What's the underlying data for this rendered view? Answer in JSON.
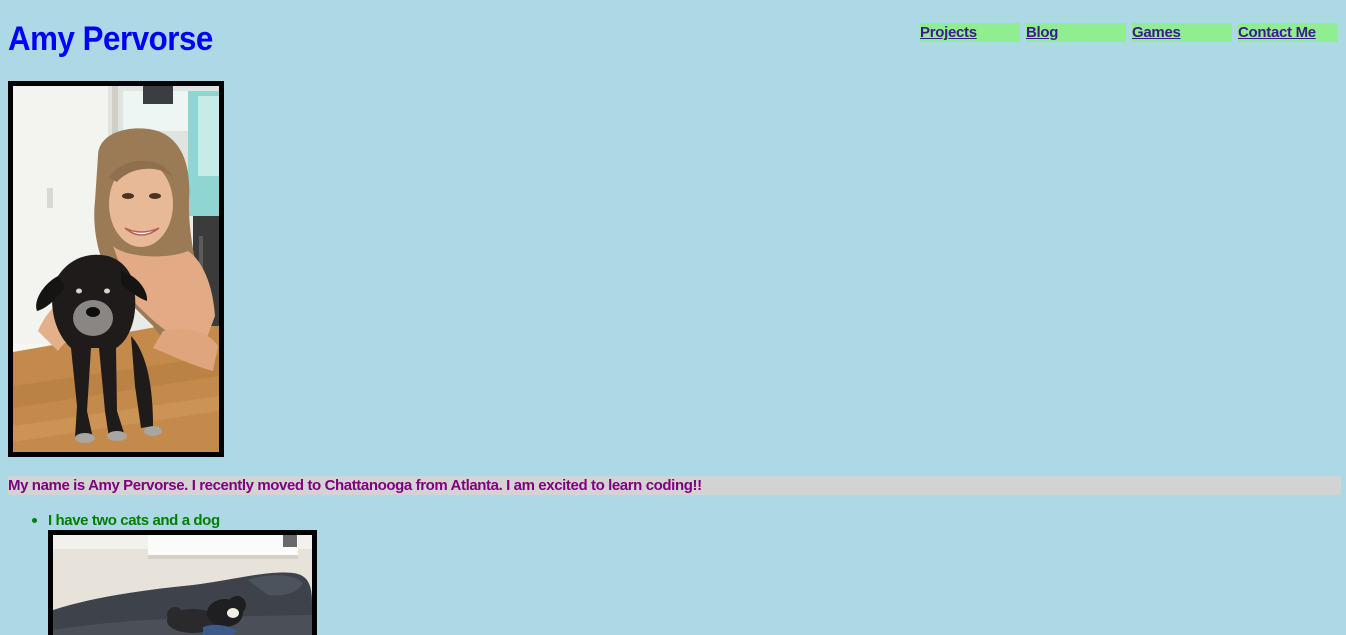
{
  "header": {
    "title": "Amy Pervorse"
  },
  "nav": {
    "items": [
      {
        "label": "Projects"
      },
      {
        "label": "Blog"
      },
      {
        "label": "Games"
      },
      {
        "label": "Contact Me"
      }
    ]
  },
  "profile": {
    "photo_icon": "photo-of-woman-with-dog"
  },
  "intro": {
    "text": "My name is Amy Pervorse. I recently moved to Chattanooga from Atlanta. I am excited to learn coding!!"
  },
  "facts": {
    "items": [
      {
        "text": "I have two cats and a dog"
      }
    ],
    "photo_icon": "photo-of-cats-on-couch"
  },
  "colors": {
    "background": "#add8e6",
    "title": "#0000ff",
    "nav_bg": "#90ee90",
    "nav_text": "#3b1b8e",
    "intro_bg": "#d3d3d3",
    "intro_text": "#800080",
    "fact_text": "#008000"
  }
}
